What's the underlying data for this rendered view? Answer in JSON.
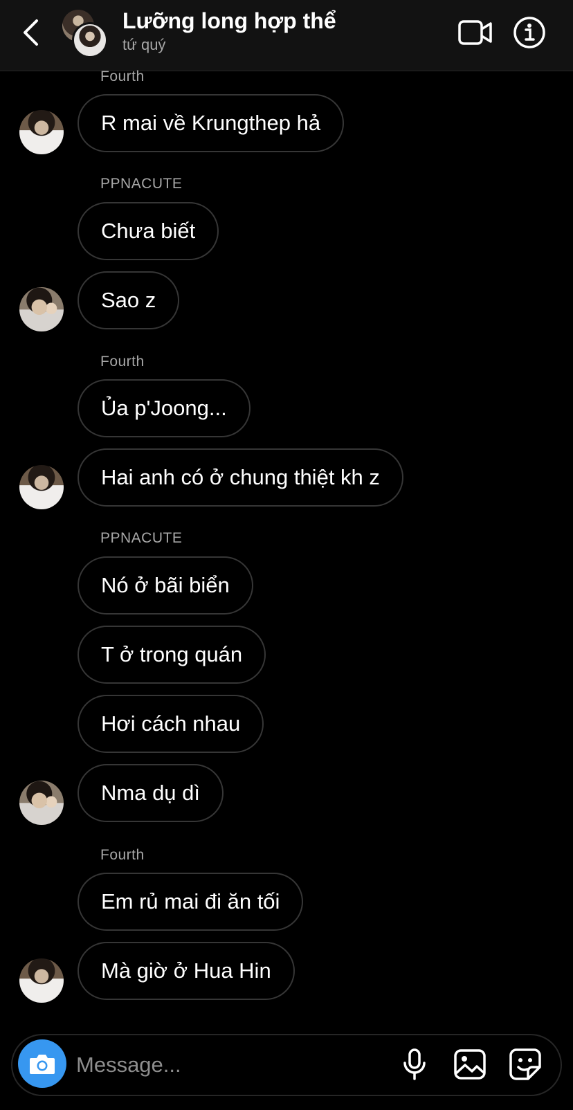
{
  "header": {
    "title": "Lưỡng long hợp thể",
    "subtitle": "tứ quý"
  },
  "messages": [
    {
      "sender": "Fourth",
      "texts": [
        "R mai về Krungthep hả"
      ]
    },
    {
      "sender": "PPNACUTE",
      "texts": [
        "Chưa biết",
        "Sao z"
      ]
    },
    {
      "sender": "Fourth",
      "texts": [
        "Ủa p'Joong...",
        "Hai anh có ở chung thiệt kh z"
      ]
    },
    {
      "sender": "PPNACUTE",
      "texts": [
        "Nó ở bãi biển",
        "T ở trong quán",
        "Hơi cách nhau",
        "Nma dụ dì"
      ]
    },
    {
      "sender": "Fourth",
      "texts": [
        "Em rủ mai đi ăn tối",
        "Mà giờ ở Hua Hin"
      ]
    }
  ],
  "composer": {
    "placeholder": "Message..."
  },
  "icons": {
    "back": "chevron-left-icon",
    "video": "video-camera-icon",
    "info": "info-icon",
    "camera": "camera-icon",
    "mic": "microphone-icon",
    "gallery": "image-icon",
    "sticker": "sticker-icon"
  },
  "colors": {
    "background": "#000000",
    "header": "#121212",
    "bubble_border": "#363636",
    "secondary_text": "#a8a8a8",
    "camera_button": "#3797f0"
  }
}
